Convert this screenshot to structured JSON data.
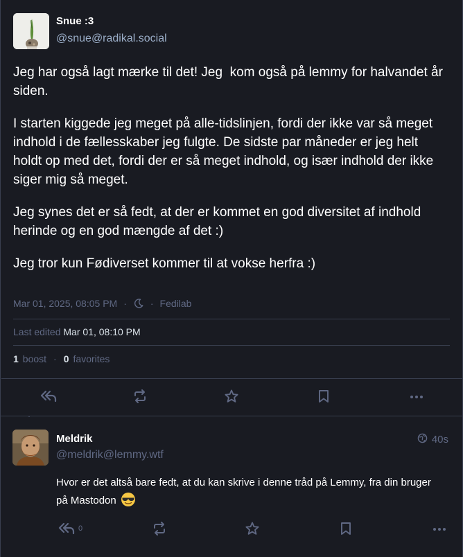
{
  "main_status": {
    "author_name": "Snue :3",
    "author_handle": "@snue@radikal.social",
    "paragraphs": [
      "Jeg har også lagt mærke til det! Jeg  kom også på lemmy for halvandet år siden.",
      "I starten kiggede jeg meget på alle-tidslinjen, fordi der ikke var så meget indhold i de fællesskaber jeg fulgte. De sidste par måneder er jeg helt holdt op med det, fordi der er så meget indhold, og især indhold der ikke siger mig så meget.",
      "Jeg synes det er så fedt, at der er kommet en god diversitet af indhold herinde og en god mængde af det :)",
      "Jeg tror kun Fødiverset kommer til at vokse herfra :)"
    ],
    "timestamp": "Mar 01, 2025, 08:05 PM",
    "visibility_icon": "moon-icon",
    "application": "Fedilab",
    "edited_label": "Last edited",
    "edited_time": "Mar 01, 08:10 PM",
    "boost_count": "1",
    "boost_label": "boost",
    "favorite_count": "0",
    "favorite_label": "favorites"
  },
  "reply_status": {
    "author_name": "Meldrik",
    "author_handle": "@meldrik@lemmy.wtf",
    "time": "40s",
    "visibility_icon": "globe-icon",
    "text": "Hvor er det altså bare fedt, at du kan skrive i denne tråd på Lemmy, fra din bruger på Mastodon",
    "emoji": "smiling-face-with-sunglasses",
    "reply_count": "0"
  },
  "colors": {
    "background": "#191b22",
    "border": "#393f4f",
    "muted": "#606984",
    "handle": "#9baec8"
  }
}
